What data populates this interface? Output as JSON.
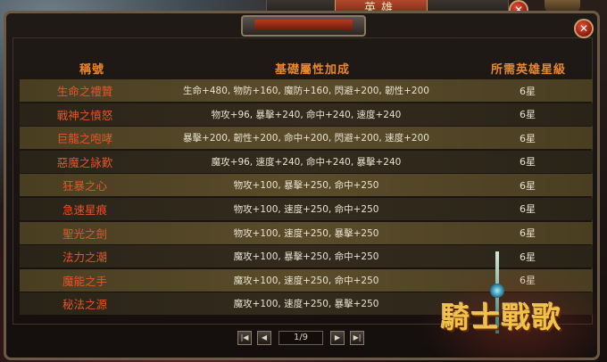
{
  "window": {
    "title": "英雄",
    "close_symbol": "✕",
    "close_icon": "close-icon"
  },
  "table": {
    "headers": {
      "title": "稱號",
      "bonus": "基礎屬性加成",
      "requirement": "所需英雄星級"
    },
    "rows": [
      {
        "title": "生命之禮贊",
        "bonus": "生命+480, 物防+160, 魔防+160, 閃避+200, 韌性+200",
        "requirement": "6星"
      },
      {
        "title": "戰神之憤怒",
        "bonus": "物攻+96, 暴擊+240, 命中+240, 速度+240",
        "requirement": "6星"
      },
      {
        "title": "巨龍之咆哮",
        "bonus": "暴擊+200, 韌性+200, 命中+200, 閃避+200, 速度+200",
        "requirement": "6星"
      },
      {
        "title": "惡魔之詠歎",
        "bonus": "魔攻+96, 速度+240, 命中+240, 暴擊+240",
        "requirement": "6星"
      },
      {
        "title": "狂暴之心",
        "bonus": "物攻+100, 暴擊+250, 命中+250",
        "requirement": "6星"
      },
      {
        "title": "急速星痕",
        "bonus": "物攻+100, 速度+250, 命中+250",
        "requirement": "6星"
      },
      {
        "title": "聖光之劍",
        "bonus": "物攻+100, 速度+250, 暴擊+250",
        "requirement": "6星"
      },
      {
        "title": "法力之潮",
        "bonus": "魔攻+100, 暴擊+250, 命中+250",
        "requirement": "6星"
      },
      {
        "title": "魔能之手",
        "bonus": "魔攻+100, 速度+250, 命中+250",
        "requirement": "6星"
      },
      {
        "title": "秘法之源",
        "bonus": "魔攻+100, 速度+250, 暴擊+250",
        "requirement": ""
      }
    ]
  },
  "pagination": {
    "first": "|◀",
    "prev": "◀",
    "page": "1/9",
    "next": "▶",
    "last": "▶|"
  },
  "logo": {
    "text": "騎士戰歌"
  },
  "colors": {
    "header": "#e8872c",
    "title_text": "#e4562c",
    "row_odd": "#5a4c2a",
    "row_even": "#332b1d"
  }
}
